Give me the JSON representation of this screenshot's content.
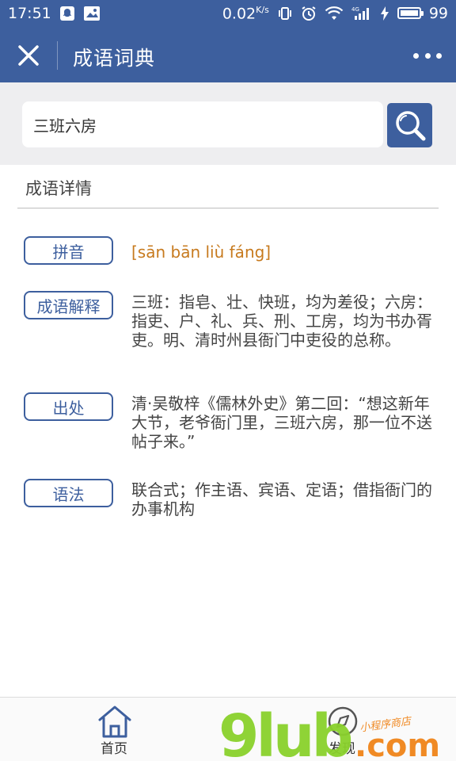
{
  "status_bar": {
    "time": "17:51",
    "network_speed": "0.02",
    "network_unit": "K/s",
    "battery_level": "99",
    "battery_fraction": 0.99
  },
  "nav": {
    "title": "成语词典"
  },
  "search": {
    "value": "三班六房"
  },
  "detail": {
    "section_title": "成语详情",
    "rows": [
      {
        "tag": "拼音",
        "text": "[sān bān liù fáng]"
      },
      {
        "tag": "成语解释",
        "text": "三班：指皂、壮、快班，均为差役；六房：指吏、户、礼、兵、刑、工房，均为书办胥吏。明、清时州县衙门中吏役的总称。"
      },
      {
        "tag": "出处",
        "text": "清·吴敬梓《儒林外史》第二回：“想这新年大节，老爷衙门里，三班六房，那一位不送帖子来。”"
      },
      {
        "tag": "语法",
        "text": "联合式；作主语、宾语、定语；借指衙门的办事机构"
      }
    ]
  },
  "tab_bar": {
    "home_label": "首页",
    "discover_label": "发现"
  },
  "watermark": {
    "text": "9lub.com",
    "subtext": "小程序商店"
  },
  "colors": {
    "primary": "#3d5f9e",
    "pinyin": "#c77a1e",
    "search_bg": "#eeeef0",
    "watermark_green": "#8ad12c",
    "watermark_orange": "#f08a24"
  }
}
